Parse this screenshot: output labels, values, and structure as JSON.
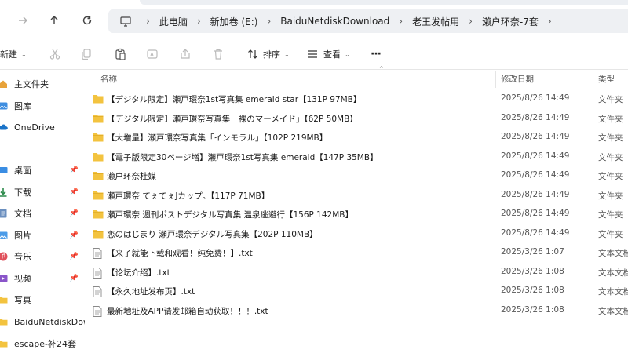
{
  "nav": {
    "breadcrumbs": [
      "此电脑",
      "新加卷 (E:)",
      "BaiduNetdiskDownload",
      "老王发帖用",
      "濑户环奈-7套"
    ]
  },
  "toolbar": {
    "new_label": "新建",
    "sort_label": "排序",
    "view_label": "查看",
    "more_label": "···"
  },
  "sidebar": {
    "items": [
      {
        "label": "主文件夹",
        "icon": "home-icon"
      },
      {
        "label": "图库",
        "icon": "gallery-icon"
      },
      {
        "label": "OneDrive",
        "icon": "cloud-icon"
      },
      {
        "label": "桌面",
        "icon": "desktop-icon",
        "pinned": true
      },
      {
        "label": "下载",
        "icon": "download-icon",
        "pinned": true
      },
      {
        "label": "文档",
        "icon": "document-icon",
        "pinned": true
      },
      {
        "label": "图片",
        "icon": "picture-icon",
        "pinned": true
      },
      {
        "label": "音乐",
        "icon": "music-icon",
        "pinned": true
      },
      {
        "label": "视频",
        "icon": "video-icon",
        "pinned": true
      },
      {
        "label": "写真",
        "icon": "folder-icon"
      },
      {
        "label": "BaiduNetdiskDow",
        "icon": "folder-icon"
      },
      {
        "label": "escape-补24套",
        "icon": "folder-icon"
      }
    ]
  },
  "columns": {
    "name": "名称",
    "date": "修改日期",
    "type": "类型"
  },
  "files": [
    {
      "name": "【デジタル限定】瀬戸環奈1st写真集 emerald star【131P 97MB】",
      "date": "2025/8/26 14:49",
      "type": "文件夹",
      "kind": "folder"
    },
    {
      "name": "【デジタル限定】瀬戸環奈写真集「裸のマーメイド」【62P 50MB】",
      "date": "2025/8/26 14:49",
      "type": "文件夹",
      "kind": "folder"
    },
    {
      "name": "【大増量】瀬戸環奈写真集「インモラル」【102P 219MB】",
      "date": "2025/8/26 14:49",
      "type": "文件夹",
      "kind": "folder"
    },
    {
      "name": "【電子版限定30ページ増】瀬戸環奈1st写真集 emerald【147P 35MB】",
      "date": "2025/8/26 14:49",
      "type": "文件夹",
      "kind": "folder"
    },
    {
      "name": "濑户环奈杜媒",
      "date": "2025/8/26 14:49",
      "type": "文件夹",
      "kind": "folder"
    },
    {
      "name": "瀬戸環奈 てぇてぇJカップ。【117P 71MB】",
      "date": "2025/8/26 14:49",
      "type": "文件夹",
      "kind": "folder"
    },
    {
      "name": "瀬戸環奈 週刊ポストデジタル写真集 温泉逃避行【156P 142MB】",
      "date": "2025/8/26 14:49",
      "type": "文件夹",
      "kind": "folder"
    },
    {
      "name": "恋のはじまり 瀬戸環奈デジタル写真集【202P 110MB】",
      "date": "2025/8/26 14:49",
      "type": "文件夹",
      "kind": "folder"
    },
    {
      "name": "【来了就能下载和观看！纯免费！】.txt",
      "date": "2025/3/26 1:07",
      "type": "文本文档",
      "kind": "text"
    },
    {
      "name": "【论坛介绍】.txt",
      "date": "2025/3/26 1:08",
      "type": "文本文档",
      "kind": "text"
    },
    {
      "name": "【永久地址发布页】.txt",
      "date": "2025/3/26 1:08",
      "type": "文本文档",
      "kind": "text"
    },
    {
      "name": "最新地址及APP请发邮箱自动获取！！！.txt",
      "date": "2025/3/26 1:08",
      "type": "文本文档",
      "kind": "text"
    }
  ],
  "colors": {
    "folder": "#f3c33f",
    "accent": "#0067c0"
  }
}
